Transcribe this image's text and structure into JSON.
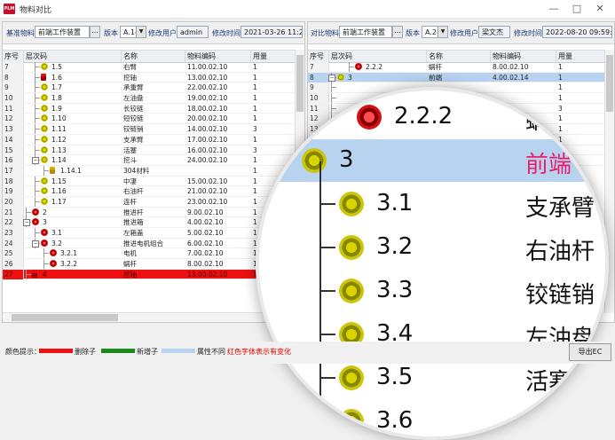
{
  "window": {
    "title": "物料对比",
    "logo": "PLM"
  },
  "left": {
    "labels": {
      "base_material": "基准物料",
      "version": "版本",
      "modifier": "修改用户",
      "modified_time": "修改时间"
    },
    "base_material": "前端工作装置",
    "version": "A.1(1",
    "modifier": "admin",
    "modified_time": "2021-03-26 11:23:22",
    "columns": [
      "序号",
      "层次码",
      "名称",
      "物料编码",
      "用量"
    ],
    "rows": [
      {
        "idx": "7",
        "code": "1.5",
        "name": "右臂",
        "mat": "11.00.02.10",
        "qty": "1"
      },
      {
        "idx": "8",
        "code": "1.6",
        "name": "挖轴",
        "mat": "13.00.02.10",
        "qty": "1"
      },
      {
        "idx": "9",
        "code": "1.7",
        "name": "承重臂",
        "mat": "22.00.02.10",
        "qty": "1"
      },
      {
        "idx": "10",
        "code": "1.8",
        "name": "左油盘",
        "mat": "19.00.02.10",
        "qty": "1"
      },
      {
        "idx": "11",
        "code": "1.9",
        "name": "长铰链",
        "mat": "18.00.02.10",
        "qty": "1"
      },
      {
        "idx": "12",
        "code": "1.10",
        "name": "短铰链",
        "mat": "20.00.02.10",
        "qty": "1"
      },
      {
        "idx": "13",
        "code": "1.11",
        "name": "铰链销",
        "mat": "14.00.02.10",
        "qty": "3"
      },
      {
        "idx": "14",
        "code": "1.12",
        "name": "支承臂",
        "mat": "17.00.02.10",
        "qty": "1"
      },
      {
        "idx": "15",
        "code": "1.13",
        "name": "活塞",
        "mat": "16.00.02.10",
        "qty": "3"
      },
      {
        "idx": "16",
        "code": "1.14",
        "name": "挖斗",
        "mat": "24.00.02.10",
        "qty": "1"
      },
      {
        "idx": "17",
        "code": "1.14.1",
        "name": "304材料",
        "mat": "",
        "qty": "1"
      },
      {
        "idx": "18",
        "code": "1.15",
        "name": "中凄",
        "mat": "15.00.02.10",
        "qty": "1"
      },
      {
        "idx": "19",
        "code": "1.16",
        "name": "右油杆",
        "mat": "21.00.02.10",
        "qty": "1"
      },
      {
        "idx": "20",
        "code": "1.17",
        "name": "连杆",
        "mat": "23.00.02.10",
        "qty": "1"
      },
      {
        "idx": "21",
        "code": "2",
        "name": "推进杆",
        "mat": "9.00.02.10",
        "qty": "1"
      },
      {
        "idx": "22",
        "code": "3",
        "name": "推进箱",
        "mat": "4.00.02.10",
        "qty": "1"
      },
      {
        "idx": "23",
        "code": "3.1",
        "name": "左箱盖",
        "mat": "5.00.02.10",
        "qty": "1"
      },
      {
        "idx": "24",
        "code": "3.2",
        "name": "推进电机组合",
        "mat": "6.00.02.10",
        "qty": "1"
      },
      {
        "idx": "25",
        "code": "3.2.1",
        "name": "电机",
        "mat": "7.00.02.10",
        "qty": "1"
      },
      {
        "idx": "26",
        "code": "3.2.2",
        "name": "蜗杆",
        "mat": "8.00.02.10",
        "qty": "1"
      },
      {
        "idx": "27",
        "code": "4",
        "name": "挖轴",
        "mat": "13.00.02.10",
        "qty": "1"
      }
    ]
  },
  "right": {
    "labels": {
      "compare_material": "对比物料",
      "version": "版本",
      "modifier": "修改用户",
      "modified_time": "修改时间"
    },
    "compare_material": "前端工作装置",
    "version": "A.2(2",
    "modifier": "梁文杰",
    "modified_time": "2022-08-20 09:59:15",
    "columns": [
      "序号",
      "层次码",
      "名称",
      "物料编码",
      "用量"
    ],
    "rows": [
      {
        "idx": "7",
        "code": "2.2.2",
        "name": "蜗杆",
        "mat": "8.00.02.10",
        "qty": "1"
      },
      {
        "idx": "8",
        "code": "3",
        "name": "前端",
        "mat": "4.00.02.14",
        "qty": "1"
      },
      {
        "idx": "9",
        "code": "",
        "name": "",
        "mat": "",
        "qty": "1"
      },
      {
        "idx": "10",
        "code": "",
        "name": "",
        "mat": "",
        "qty": "1"
      },
      {
        "idx": "11",
        "code": "",
        "name": "",
        "mat": "",
        "qty": "3"
      },
      {
        "idx": "12",
        "code": "",
        "name": "",
        "mat": "",
        "qty": "1"
      },
      {
        "idx": "13",
        "code": "",
        "name": "",
        "mat": "",
        "qty": "1"
      },
      {
        "idx": "14",
        "code": "",
        "name": "",
        "mat": "",
        "qty": "1"
      },
      {
        "idx": "15",
        "code": "",
        "name": "",
        "mat": "",
        "qty": "1"
      },
      {
        "idx": "16",
        "code": "",
        "name": "",
        "mat": "",
        "qty": "1"
      }
    ]
  },
  "magnified": {
    "rows": [
      {
        "code": "2.2.2",
        "name": "蜗"
      },
      {
        "code": "3",
        "name": "前端"
      },
      {
        "code": "3.1",
        "name": "支承臂"
      },
      {
        "code": "3.2",
        "name": "右油杆"
      },
      {
        "code": "3.3",
        "name": "铰链销"
      },
      {
        "code": "3.4",
        "name": "左油盘"
      },
      {
        "code": "3.5",
        "name": "活塞"
      },
      {
        "code": "3.6",
        "name": "挖"
      }
    ]
  },
  "legend": {
    "label": "颜色提示：",
    "deleted": "删除子",
    "added": "新增子",
    "attr_diff": "属性不同",
    "red_font_note": "红色字体表示有变化",
    "export_button": "导出EC",
    "colors": {
      "deleted": "#ee1111",
      "added": "#1a8a1a",
      "attr_diff": "#b8d3f0",
      "note": "#e00000"
    }
  }
}
